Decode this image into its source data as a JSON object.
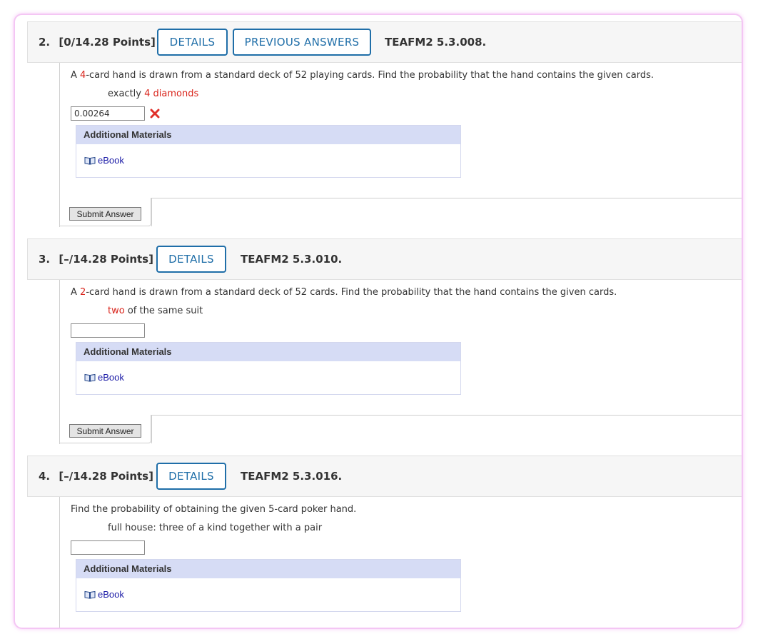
{
  "questions": [
    {
      "number": "2.",
      "points": "[0/14.28 Points]",
      "buttons": [
        "DETAILS",
        "PREVIOUS ANSWERS"
      ],
      "code": "TEAFM2 5.3.008.",
      "text_prefix": "A ",
      "text_highlight": "4",
      "text_suffix": "-card hand is drawn from a standard deck of 52 playing cards. Find the probability that the hand contains the given cards.",
      "sub_prefix": "exactly ",
      "sub_highlight": "4 diamonds",
      "sub_suffix": "",
      "answer_value": "0.00264",
      "answer_status": "incorrect",
      "additional_materials_title": "Additional Materials",
      "ebook_label": "eBook",
      "submit_label": "Submit Answer"
    },
    {
      "number": "3.",
      "points": "[–/14.28 Points]",
      "buttons": [
        "DETAILS"
      ],
      "code": "TEAFM2 5.3.010.",
      "text_prefix": "A ",
      "text_highlight": "2",
      "text_suffix": "-card hand is drawn from a standard deck of 52 cards. Find the probability that the hand contains the given cards.",
      "sub_prefix": "",
      "sub_highlight": "two",
      "sub_suffix": " of the same suit",
      "answer_value": "",
      "additional_materials_title": "Additional Materials",
      "ebook_label": "eBook",
      "submit_label": "Submit Answer"
    },
    {
      "number": "4.",
      "points": "[–/14.28 Points]",
      "buttons": [
        "DETAILS"
      ],
      "code": "TEAFM2 5.3.016.",
      "text_prefix": "Find the probability of obtaining the given 5-card poker hand.",
      "sub_prefix": "full house: three of a kind together with a pair",
      "answer_value": "",
      "additional_materials_title": "Additional Materials",
      "ebook_label": "eBook"
    }
  ],
  "colors": {
    "accent": "#1f6ea8",
    "highlight_red": "#d9241b",
    "materials_header": "#d6dcf5",
    "link": "#1a1aa6"
  }
}
